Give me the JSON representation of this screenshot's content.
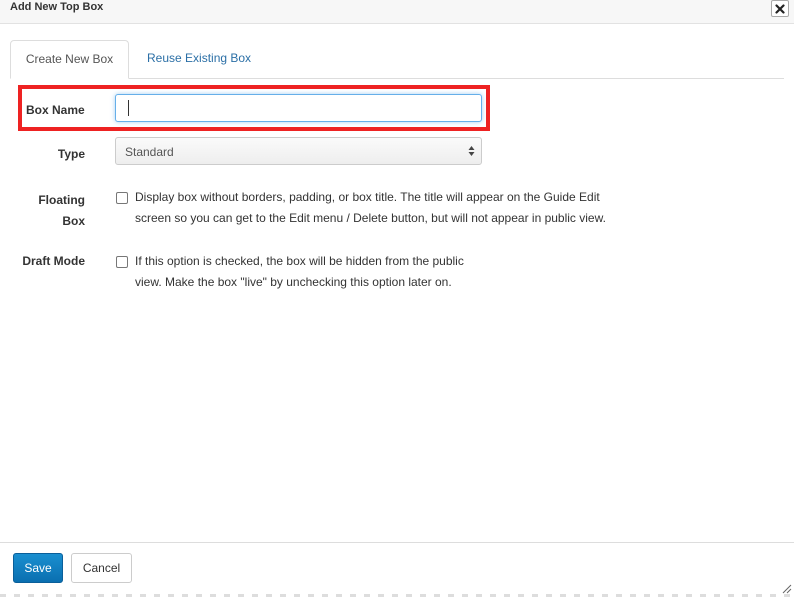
{
  "dialog": {
    "title": "Add New Top Box",
    "close_icon": "close-icon"
  },
  "tabs": [
    {
      "label": "Create New Box",
      "active": true
    },
    {
      "label": "Reuse Existing Box",
      "active": false
    }
  ],
  "form": {
    "box_name": {
      "label": "Box Name",
      "value": "",
      "placeholder": ""
    },
    "type": {
      "label": "Type",
      "selected": "Standard"
    },
    "floating": {
      "label_line1": "Floating",
      "label_line2": "Box",
      "checked": false,
      "desc_line1": "Display box without borders, padding, or box title. The title will appear on the Guide Edit",
      "desc_line2": "screen so you can get to the Edit menu / Delete button, but will not appear in public view."
    },
    "draft": {
      "label": "Draft Mode",
      "checked": false,
      "desc_line1": "If this option is checked, the box will be hidden from the public",
      "desc_line2": "view. Make the box \"live\" by unchecking this option later on."
    }
  },
  "footer": {
    "save_label": "Save",
    "cancel_label": "Cancel"
  },
  "colors": {
    "highlight": "#ee2222",
    "primary": "#0a6fb0",
    "link": "#2b6fa6"
  }
}
